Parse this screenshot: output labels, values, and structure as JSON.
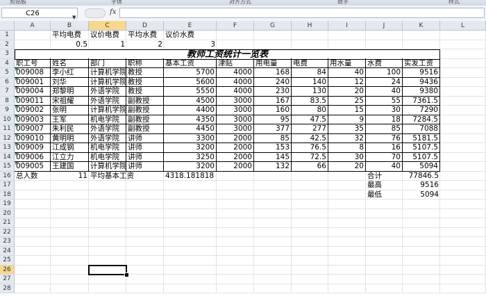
{
  "ribbon": {
    "groups": [
      "剪贴板",
      "字体",
      "对齐方式",
      "数字",
      "样式"
    ]
  },
  "formula_bar": {
    "namebox": "C26",
    "fx": "fx",
    "formula": ""
  },
  "columns": [
    "A",
    "B",
    "C",
    "D",
    "E",
    "F",
    "G",
    "H",
    "I",
    "J",
    "K",
    "L"
  ],
  "selected_column": "C",
  "rows": [
    "1",
    "2",
    "3",
    "4",
    "5",
    "6",
    "7",
    "8",
    "9",
    "10",
    "11",
    "12",
    "13",
    "14",
    "15",
    "16",
    "17",
    "18",
    "19",
    "20",
    "21",
    "22",
    "23",
    "24",
    "25",
    "26",
    "27",
    "28"
  ],
  "selected_row": "26",
  "params": {
    "labels": [
      "平均电费",
      "议价电费",
      "平均水费",
      "议价水费"
    ],
    "values": [
      "0.5",
      "1",
      "2",
      "3"
    ]
  },
  "title": "教师工资统计一览表",
  "headers": [
    "职工号",
    "姓名",
    "部门",
    "职称",
    "基本工资",
    "津贴",
    "用电量",
    "电费",
    "用水量",
    "水费",
    "实发工资"
  ],
  "records": [
    [
      "009008",
      "李小红",
      "计算机学院",
      "教授",
      "5700",
      "4000",
      "168",
      "84",
      "40",
      "100",
      "9516"
    ],
    [
      "009001",
      "刘华",
      "计算机学院",
      "教授",
      "5600",
      "4000",
      "240",
      "140",
      "12",
      "24",
      "9436"
    ],
    [
      "009004",
      "郑黎明",
      "外语学院",
      "教授",
      "5550",
      "4000",
      "230",
      "130",
      "20",
      "40",
      "9380"
    ],
    [
      "009011",
      "宋祖耀",
      "外语学院",
      "副教授",
      "4500",
      "3000",
      "167",
      "83.5",
      "25",
      "55",
      "7361.5"
    ],
    [
      "009002",
      "张明",
      "计算机学院",
      "副教授",
      "4400",
      "3000",
      "160",
      "80",
      "15",
      "30",
      "7290"
    ],
    [
      "009003",
      "王军",
      "机电学院",
      "副教授",
      "4350",
      "3000",
      "95",
      "47.5",
      "9",
      "18",
      "7284.5"
    ],
    [
      "009007",
      "朱利民",
      "外语学院",
      "副教授",
      "4450",
      "3000",
      "377",
      "277",
      "35",
      "85",
      "7088"
    ],
    [
      "009010",
      "黄明明",
      "外语学院",
      "讲师",
      "3300",
      "2000",
      "85",
      "42.5",
      "32",
      "76",
      "5181.5"
    ],
    [
      "009009",
      "江成钢",
      "机电学院",
      "讲师",
      "3200",
      "2000",
      "153",
      "76.5",
      "8",
      "16",
      "5107.5"
    ],
    [
      "009006",
      "江立力",
      "机电学院",
      "讲师",
      "3250",
      "2000",
      "145",
      "72.5",
      "30",
      "70",
      "5107.5"
    ],
    [
      "009005",
      "王建国",
      "计算机学院",
      "讲师",
      "3200",
      "2000",
      "132",
      "66",
      "20",
      "40",
      "5094"
    ]
  ],
  "summary": {
    "total_label": "总人数",
    "total_value": "11",
    "avg_label": "平均基本工资",
    "avg_value": "4318.181818",
    "sum_label": "合计",
    "sum_value": "77846.5",
    "max_label": "最高",
    "max_value": "9516",
    "min_label": "最低",
    "min_value": "5094"
  }
}
